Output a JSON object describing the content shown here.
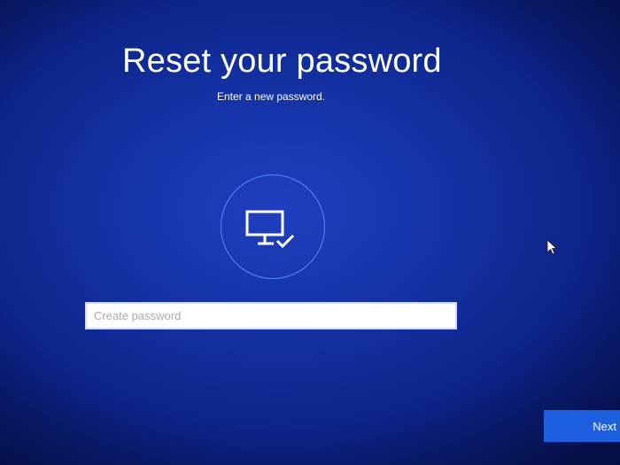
{
  "header": {
    "title": "Reset your password",
    "subtitle": "Enter a new password."
  },
  "avatar": {
    "icon": "monitor-check-icon"
  },
  "password": {
    "placeholder": "Create password",
    "value": ""
  },
  "footer": {
    "next_label": "Next"
  },
  "colors": {
    "background": "#1533a6",
    "accent": "#1e5fe0",
    "ring": "#4f8dff"
  }
}
